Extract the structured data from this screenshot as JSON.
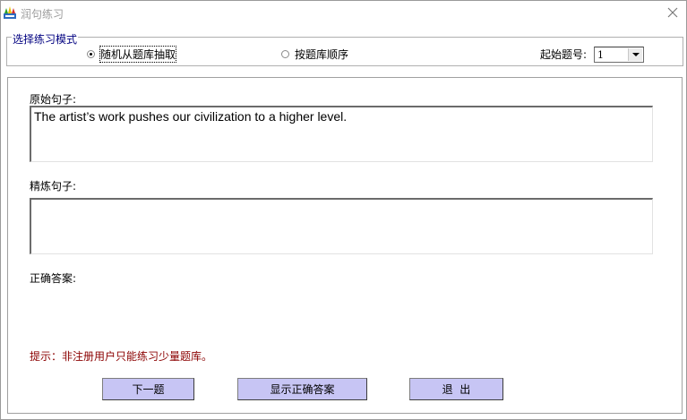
{
  "window": {
    "title": "润句练习"
  },
  "mode": {
    "legend": "选择练习模式",
    "options": [
      {
        "label": "随机从题库抽取",
        "selected": true
      },
      {
        "label": "按题库顺序",
        "selected": false
      }
    ],
    "start_label": "起始题号:",
    "start_value": "1"
  },
  "fields": {
    "original_label": "原始句子:",
    "original_text": "The artist’s work pushes our civilization to a higher level.",
    "refined_label": "精炼句子:",
    "refined_text": "",
    "answer_label": "正确答案:",
    "answer_text": ""
  },
  "hint": "提示：非注册用户只能练习少量题库。",
  "buttons": {
    "next": "下一题",
    "show_answer": "显示正确答案",
    "exit": "退  出"
  },
  "colors": {
    "button_bg": "#c7c5f4",
    "hint": "#8b0000",
    "legend": "#000080"
  }
}
